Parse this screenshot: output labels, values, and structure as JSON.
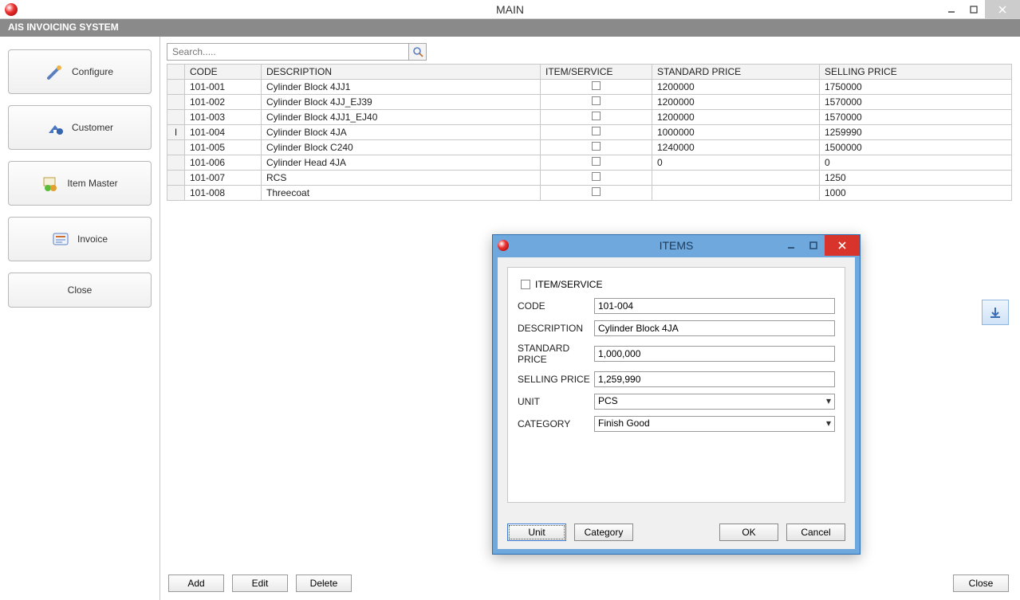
{
  "window": {
    "title": "MAIN"
  },
  "app": {
    "header": "AIS INVOICING SYSTEM"
  },
  "sidebar": {
    "configure": "Configure",
    "customer": "Customer",
    "item_master": "Item Master",
    "invoice": "Invoice",
    "close": "Close"
  },
  "search": {
    "placeholder": "Search....."
  },
  "table": {
    "headers": {
      "code": "CODE",
      "description": "DESCRIPTION",
      "item_service": "ITEM/SERVICE",
      "standard_price": "STANDARD PRICE",
      "selling_price": "SELLING PRICE"
    },
    "rows": [
      {
        "marker": "",
        "code": "101-001",
        "description": "Cylinder Block 4JJ1",
        "standard_price": "1200000",
        "selling_price": "1750000"
      },
      {
        "marker": "",
        "code": "101-002",
        "description": "Cylinder Block 4JJ_EJ39",
        "standard_price": "1200000",
        "selling_price": "1570000"
      },
      {
        "marker": "",
        "code": "101-003",
        "description": "Cylinder Block 4JJ1_EJ40",
        "standard_price": "1200000",
        "selling_price": "1570000"
      },
      {
        "marker": "I",
        "code": "101-004",
        "description": "Cylinder Block 4JA",
        "standard_price": "1000000",
        "selling_price": "1259990"
      },
      {
        "marker": "",
        "code": "101-005",
        "description": "Cylinder Block C240",
        "standard_price": "1240000",
        "selling_price": "1500000"
      },
      {
        "marker": "",
        "code": "101-006",
        "description": "Cylinder Head 4JA",
        "standard_price": "0",
        "selling_price": "0"
      },
      {
        "marker": "",
        "code": "101-007",
        "description": "RCS",
        "standard_price": "",
        "selling_price": "1250"
      },
      {
        "marker": "",
        "code": "101-008",
        "description": "Threecoat",
        "standard_price": "",
        "selling_price": "1000"
      }
    ]
  },
  "footer": {
    "add": "Add",
    "edit": "Edit",
    "delete": "Delete",
    "close": "Close"
  },
  "modal": {
    "title": "ITEMS",
    "item_service_label": "ITEM/SERVICE",
    "labels": {
      "code": "CODE",
      "description": "DESCRIPTION",
      "standard_price": "STANDARD PRICE",
      "selling_price": "SELLING PRICE",
      "unit": "UNIT",
      "category": "CATEGORY"
    },
    "values": {
      "code": "101-004",
      "description": "Cylinder Block 4JA",
      "standard_price": "1,000,000",
      "selling_price": "1,259,990",
      "unit": "PCS",
      "category": "Finish Good"
    },
    "buttons": {
      "unit": "Unit",
      "category": "Category",
      "ok": "OK",
      "cancel": "Cancel"
    }
  }
}
